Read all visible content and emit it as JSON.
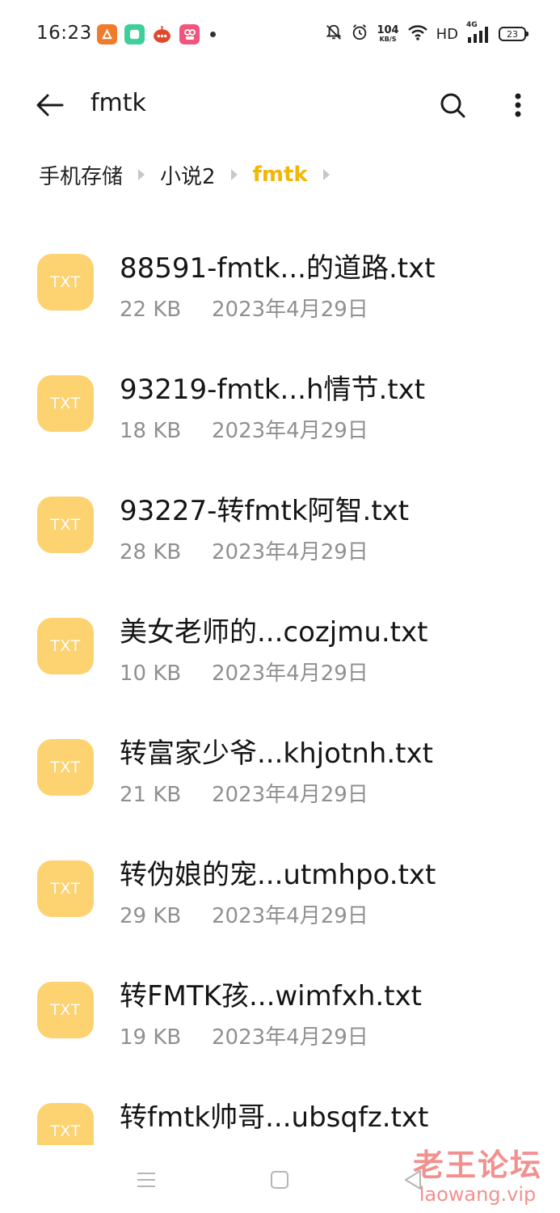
{
  "status_bar": {
    "time": "16:23",
    "net_speed_value": "104",
    "net_speed_unit": "KB/S",
    "hd_label": "HD",
    "signal_label": "4G",
    "battery_level": "23",
    "icons": [
      "app-icon-orange",
      "app-icon-green",
      "app-icon-red-chat",
      "app-icon-pink",
      "mute-icon",
      "alarm-icon",
      "wifi-icon",
      "signal-icon",
      "battery-icon"
    ]
  },
  "header": {
    "title": "fmtk",
    "back_icon": "arrow-left-icon",
    "search_icon": "search-icon",
    "more_icon": "more-vertical-icon"
  },
  "breadcrumb": {
    "items": [
      "手机存储",
      "小说2",
      "fmtk"
    ],
    "active_color": "#f2b705"
  },
  "files": {
    "icon_label": "TXT",
    "icon_color": "#fdd270",
    "items": [
      {
        "name": "88591-fmtk...的道路.txt",
        "size": "22 KB",
        "date": "2023年4月29日"
      },
      {
        "name": "93219-fmtk...h情节.txt",
        "size": "18 KB",
        "date": "2023年4月29日"
      },
      {
        "name": "93227-转fmtk阿智.txt",
        "size": "28 KB",
        "date": "2023年4月29日"
      },
      {
        "name": "美女老师的...cozjmu.txt",
        "size": "10 KB",
        "date": "2023年4月29日"
      },
      {
        "name": "转富家少爷...khjotnh.txt",
        "size": "21 KB",
        "date": "2023年4月29日"
      },
      {
        "name": "转伪娘的宠...utmhpo.txt",
        "size": "29 KB",
        "date": "2023年4月29日"
      },
      {
        "name": "转FMTK孩...wimfxh.txt",
        "size": "19 KB",
        "date": "2023年4月29日"
      },
      {
        "name": "转fmtk帅哥...ubsqfz.txt",
        "size": "",
        "date": ""
      }
    ]
  },
  "nav_bar": {
    "icons": [
      "menu-icon",
      "home-icon",
      "back-triangle-icon"
    ]
  },
  "watermark": {
    "text_cn": "老王论坛",
    "text_en": "laowang.vip"
  }
}
